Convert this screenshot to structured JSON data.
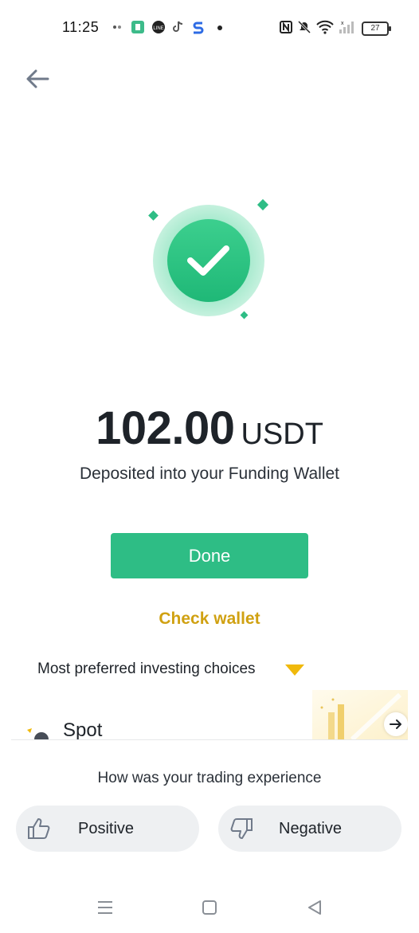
{
  "status_bar": {
    "time": "11:25",
    "battery": "27",
    "icons": [
      "notification-icon",
      "app-icon",
      "line-icon",
      "tiktok-icon",
      "s-app-icon",
      "dot-icon",
      "nfc-icon",
      "mute-icon",
      "wifi-icon",
      "signal-icon",
      "battery-icon"
    ]
  },
  "deposit": {
    "amount": "102.00",
    "currency": "USDT",
    "subtitle": "Deposited into your Funding Wallet"
  },
  "actions": {
    "done_label": "Done",
    "check_wallet_label": "Check wallet"
  },
  "choices": {
    "title": "Most preferred investing choices",
    "card_label": "Spot"
  },
  "feedback": {
    "question": "How was your trading experience",
    "positive_label": "Positive",
    "negative_label": "Negative"
  },
  "colors": {
    "accent_green": "#2ebd85",
    "link_gold": "#d0a112",
    "text": "#1e2329"
  }
}
